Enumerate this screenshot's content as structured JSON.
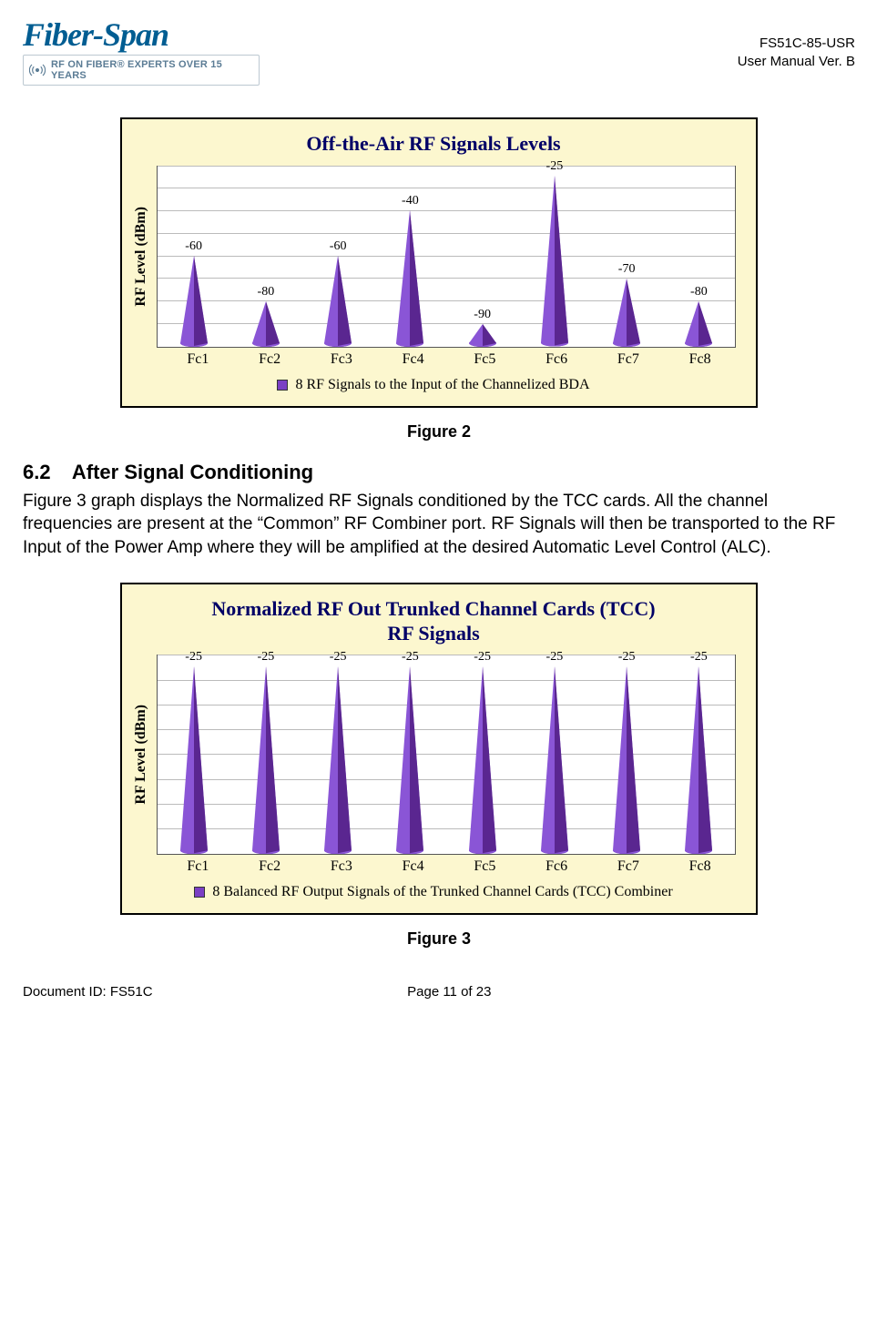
{
  "header": {
    "logo_brand": "Fiber-Span",
    "logo_tagline": "RF ON FIBER® EXPERTS OVER 15 YEARS",
    "doc_code": "FS51C-85-USR",
    "doc_version": "User Manual Ver. B"
  },
  "chart_data": [
    {
      "type": "bar",
      "title": "Off-the-Air RF Signals Levels",
      "ylabel": "RF Level (dBm)",
      "categories": [
        "Fc1",
        "Fc2",
        "Fc3",
        "Fc4",
        "Fc5",
        "Fc6",
        "Fc7",
        "Fc8"
      ],
      "values": [
        -60,
        -80,
        -60,
        -40,
        -90,
        -25,
        -70,
        -80
      ],
      "min": -100,
      "max": -20,
      "legend": "8 RF Signals to the Input of the Channelized BDA"
    },
    {
      "type": "bar",
      "title_line1": "Normalized RF Out Trunked Channel Cards (TCC)",
      "title_line2": "RF Signals",
      "ylabel": "RF Level (dBm)",
      "categories": [
        "Fc1",
        "Fc2",
        "Fc3",
        "Fc4",
        "Fc5",
        "Fc6",
        "Fc7",
        "Fc8"
      ],
      "values": [
        -25,
        -25,
        -25,
        -25,
        -25,
        -25,
        -25,
        -25
      ],
      "min": -100,
      "max": -20,
      "legend": "8 Balanced RF Output Signals of the Trunked Channel Cards (TCC) Combiner"
    }
  ],
  "captions": {
    "fig2": "Figure 2",
    "fig3": "Figure 3"
  },
  "section": {
    "num": "6.2",
    "title": "After Signal Conditioning",
    "body": "Figure 3 graph displays the Normalized RF Signals conditioned by the TCC cards. All the channel frequencies are present at the “Common” RF Combiner port.  RF Signals will then be transported to the RF Input of the Power Amp where they will be amplified at the desired Automatic Level Control (ALC)."
  },
  "footer": {
    "doc_id": "Document ID: FS51C",
    "page": "Page 11 of 23"
  }
}
